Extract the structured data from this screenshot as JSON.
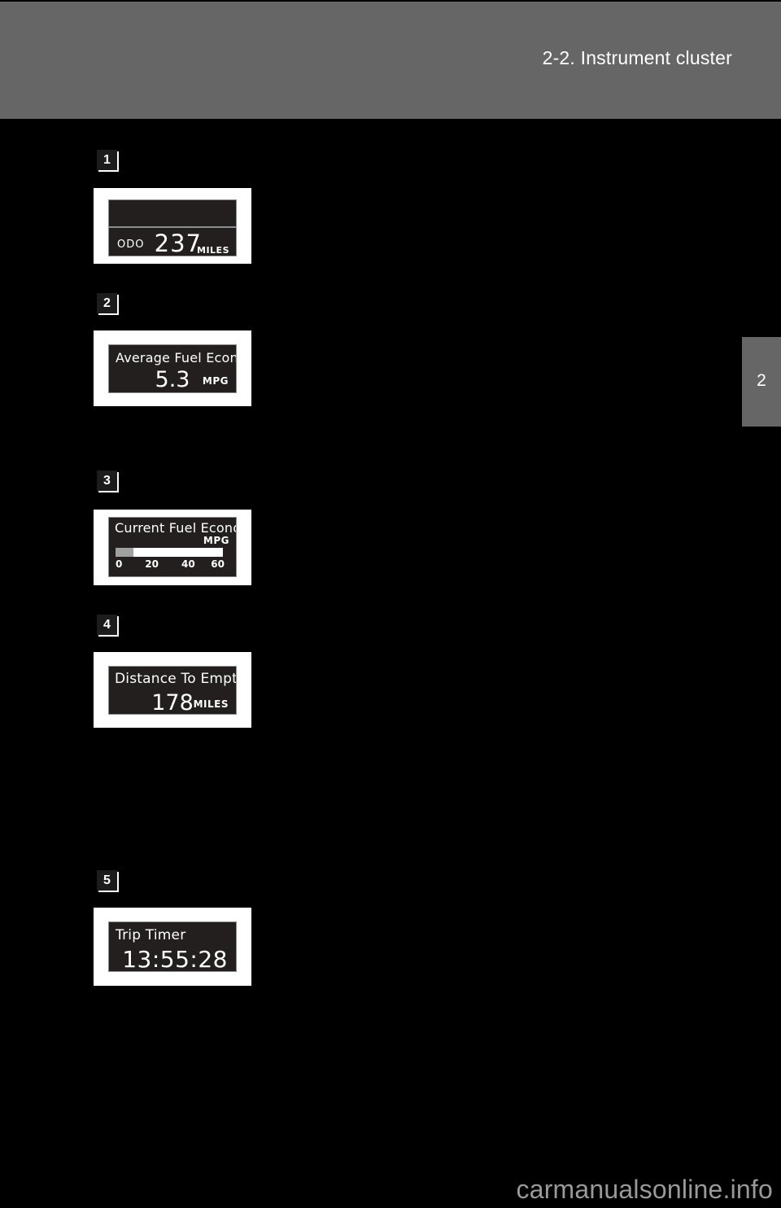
{
  "header": {
    "title": "2-2. Instrument cluster"
  },
  "chapter_tab": {
    "number": "2"
  },
  "panels": [
    {
      "badge": "1",
      "screen_type": "odometer",
      "label": "ODO",
      "value": "237",
      "unit": "MILES"
    },
    {
      "badge": "2",
      "screen_type": "average-fuel-economy",
      "title": "Average Fuel Economy",
      "value": "5.3",
      "unit": "MPG"
    },
    {
      "badge": "3",
      "screen_type": "current-fuel-economy",
      "title": "Current Fuel Economy",
      "unit": "MPG",
      "gauge": {
        "fill_percent": 17,
        "ticks": [
          "0",
          "20",
          "40",
          "60"
        ],
        "min": 0,
        "max": 60
      }
    },
    {
      "badge": "4",
      "screen_type": "distance-to-empty",
      "title": "Distance To Empty",
      "value": "178",
      "unit": "MILES"
    },
    {
      "badge": "5",
      "screen_type": "trip-timer",
      "title": "Trip Timer",
      "value": "13:55:28"
    }
  ],
  "footer": {
    "watermark": "carmanualsonline.info"
  },
  "colors": {
    "header_gray": "#666666",
    "page_black": "#000000",
    "card_white": "#ffffff",
    "lcd_dark": "#231f1f",
    "lcd_border": "#8d8d8d",
    "gauge_fill": "#a0a0a0",
    "watermark_gray": "#999999"
  }
}
